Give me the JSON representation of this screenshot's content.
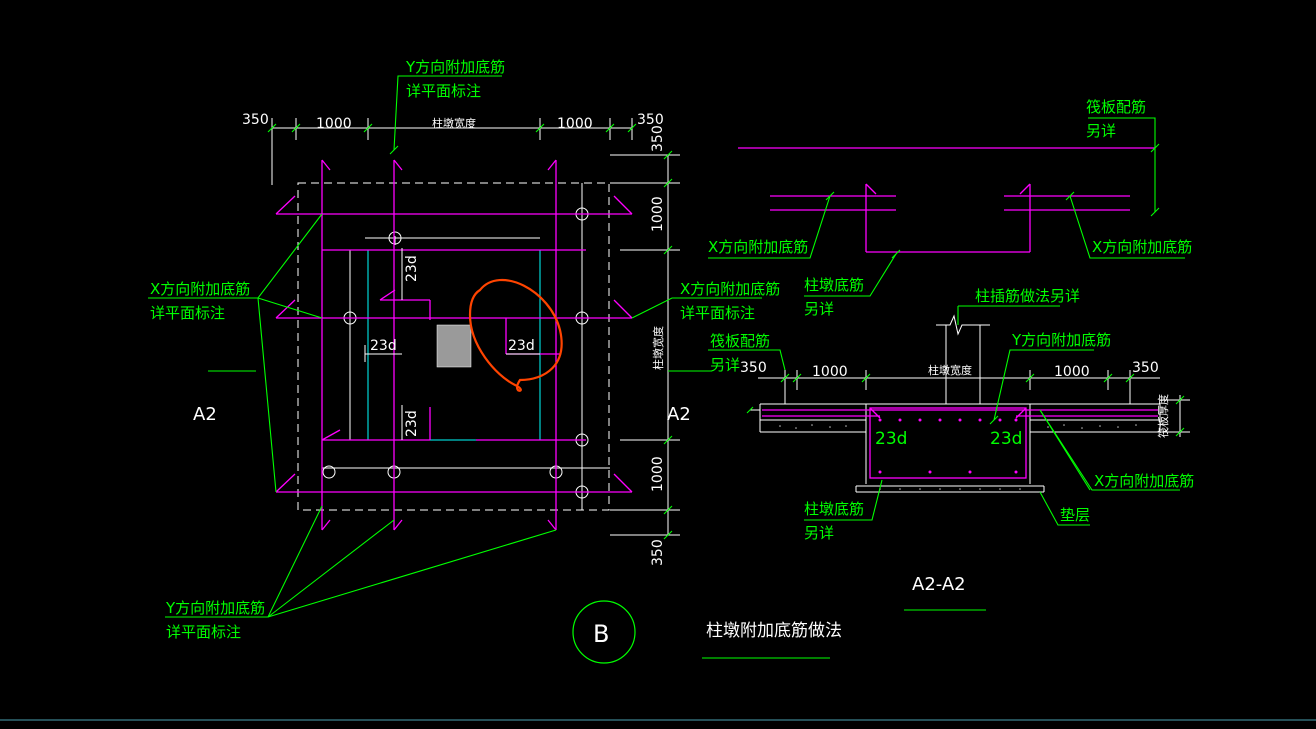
{
  "plan": {
    "dims_top": [
      "350",
      "1000",
      "柱墩宽度",
      "1000",
      "350"
    ],
    "dims_right": [
      "350",
      "1000",
      "柱墩宽度",
      "1000",
      "350"
    ],
    "lap_23d": "23d",
    "note_y_top": [
      "Y方向附加底筋",
      "详平面标注"
    ],
    "note_x_left": [
      "X方向附加底筋",
      "详平面标注"
    ],
    "note_x_right": [
      "X方向附加底筋",
      "详平面标注"
    ],
    "note_y_bottom": [
      "Y方向附加底筋",
      "详平面标注"
    ],
    "section_mark": "A2"
  },
  "section": {
    "upper_note_raft": [
      "筏板配筋",
      "另详"
    ],
    "upper_note_x_left": "X方向附加底筋",
    "upper_note_x_right": "X方向附加底筋",
    "upper_note_pier": [
      "柱墩底筋",
      "另详"
    ],
    "column_note": "柱插筋做法另详",
    "y_note": "Y方向附加底筋",
    "raft_note": [
      "筏板配筋",
      "另详"
    ],
    "dims": [
      "350",
      "1000",
      "柱墩宽度",
      "1000",
      "350"
    ],
    "raft_thickness": "筏板厚度",
    "lap_23d": "23d",
    "x_note": "X方向附加底筋",
    "pier_note": [
      "柱墩底筋",
      "另详"
    ],
    "cushion_note": "垫层",
    "section_title": "A2-A2"
  },
  "detail_circle": "B",
  "title": "柱墩附加底筋做法",
  "colors": {
    "background": "#000000",
    "rebar": "#ff00ff",
    "leader": "#00ff00",
    "dimension": "#ffffff",
    "inner": "#00ffff",
    "column": "#9a9a9a",
    "markup": "#ff4400"
  }
}
